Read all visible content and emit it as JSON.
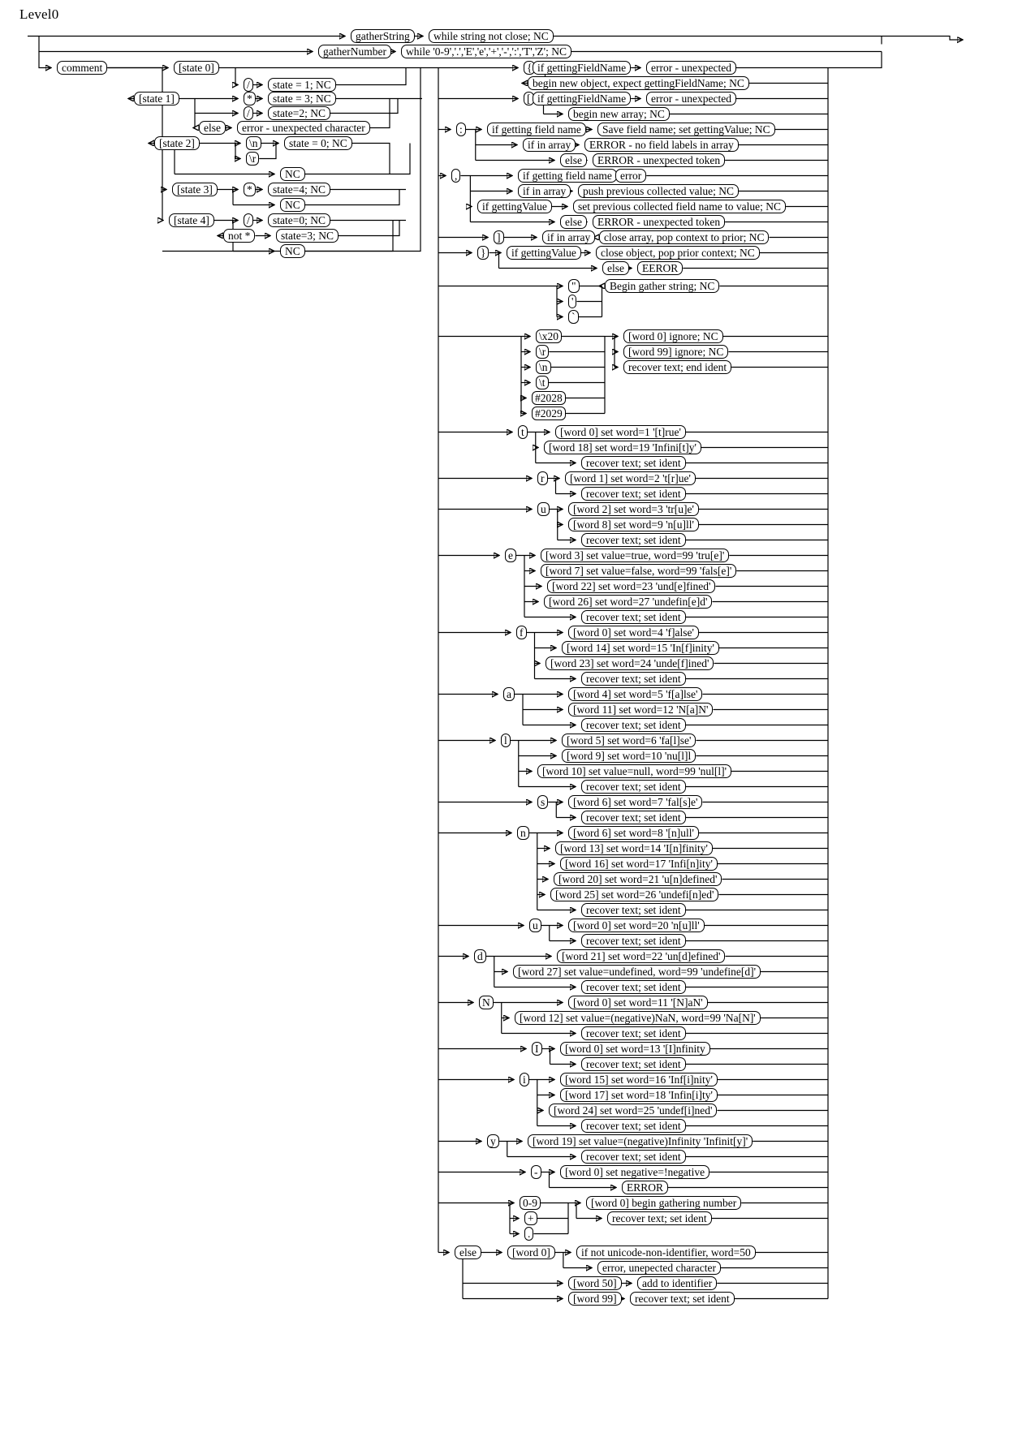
{
  "title": "Level0",
  "diagram": {
    "type": "railroad-syntax-diagram",
    "name": "Level0 JSON tokenizer state machine"
  },
  "top": {
    "gather_string": "gatherString",
    "while_string": "while string not close; NC",
    "gather_number": "gatherNumber",
    "while_number": "while '0-9','.','E','e','+','-',':','T','Z'; NC",
    "comment": "comment"
  },
  "comment_states": {
    "state0": "[state 0]",
    "state0_tok": "/",
    "state0_act": "state = 1; NC",
    "state1": "[state 1]",
    "state1_rows": [
      {
        "tok": "*",
        "act": "state = 3; NC"
      },
      {
        "tok": "/",
        "act": "state=2; NC"
      },
      {
        "tok": "else",
        "act": "error - unexpected character"
      }
    ],
    "state2": "[state 2]",
    "state2_tok_a": "\\n",
    "state2_tok_b": "\\r",
    "state2_act": "state = 0; NC",
    "state2_nc": "NC",
    "state3": "[state 3]",
    "state3_tok": "*",
    "state3_act": "state=4; NC",
    "state3_nc": "NC",
    "state4": "[state 4]",
    "state4_rows": [
      {
        "tok": "/",
        "act": "state=0; NC"
      },
      {
        "tok": "not *",
        "act": "state=3; NC"
      }
    ],
    "state4_nc": "NC"
  },
  "tokens": [
    {
      "id": "open-brace",
      "tok": "{",
      "rows": [
        {
          "cond": "if gettingFieldName",
          "act": "error - unexpected"
        },
        {
          "cond": null,
          "act": "begin new object, expect gettingFieldName; NC"
        }
      ]
    },
    {
      "id": "open-bracket",
      "tok": "[",
      "rows": [
        {
          "cond": "if gettingFieldName",
          "act": "error - unexpected"
        },
        {
          "cond": null,
          "act": "begin new array; NC"
        }
      ]
    },
    {
      "id": "colon",
      "tok": ":",
      "rows": [
        {
          "cond": "if getting field name",
          "act": "Save field name; set gettingValue; NC"
        },
        {
          "cond": "if in array",
          "act": "ERROR - no field labels in array"
        },
        {
          "cond": "else",
          "act": "ERROR - unexpected token"
        }
      ]
    },
    {
      "id": "comma",
      "tok": ",",
      "rows": [
        {
          "cond": "if getting field name",
          "act": "error"
        },
        {
          "cond": "if in array",
          "act": "push previous collected value; NC"
        },
        {
          "cond": "if gettingValue",
          "act": "set previous collected field name to value; NC"
        },
        {
          "cond": "else",
          "act": "ERROR - unexpected token"
        }
      ]
    },
    {
      "id": "close-bracket",
      "tok": "]",
      "rows": [
        {
          "cond": "if in array",
          "act": "close array, pop context to prior; NC"
        }
      ]
    },
    {
      "id": "close-brace",
      "tok": "}",
      "rows": [
        {
          "cond": "if gettingValue",
          "act": "close object, pop prior context; NC"
        },
        {
          "cond": "else",
          "act": "EEROR"
        }
      ]
    }
  ],
  "quotes": {
    "marks": [
      "\"",
      "'",
      "`"
    ],
    "action": "Begin gather string; NC"
  },
  "whitespace": {
    "marks": [
      "\\x20",
      "\\r",
      "\\n",
      "\\t",
      "#2028",
      "#2029"
    ],
    "actions": [
      "[word 0] ignore; NC",
      "[word 99] ignore; NC",
      "recover text; end ident"
    ]
  },
  "letters": [
    {
      "ch": "t",
      "rows": [
        "[word 0] set word=1 '[t]rue'",
        "[word 18] set word=19 'Infini[t]y'",
        "recover text; set ident"
      ]
    },
    {
      "ch": "r",
      "rows": [
        "[word 1] set word=2 't[r]ue'",
        "recover text; set ident"
      ]
    },
    {
      "ch": "u",
      "rows": [
        "[word 2] set word=3 'tr[u]e'",
        "[word 8] set word=9 'n[u]ll'",
        "recover text; set ident"
      ]
    },
    {
      "ch": "e",
      "rows": [
        "[word 3] set value=true, word=99  'tru[e]'",
        "[word 7] set value=false, word=99 'fals[e]'",
        "[word 22] set word=23 'und[e]fined'",
        "[word 26] set word=27 'undefin[e]d'",
        "recover text; set ident"
      ]
    },
    {
      "ch": "f",
      "rows": [
        "[word 0] set word=4  'f]alse'",
        "[word 14] set word=15 'In[f]inity'",
        "[word 23] set word=24 'unde[f]ined'",
        "recover text; set ident"
      ]
    },
    {
      "ch": "a",
      "rows": [
        "[word 4] set word=5 'f[a]lse'",
        "[word 11] set word=12 'N[a]N'",
        "recover text; set ident"
      ]
    },
    {
      "ch": "l",
      "rows": [
        "[word 5] set word=6 'fa[l]se'",
        "[word 9] set word=10 'nu[l]l",
        "[word 10] set value=null, word=99  'nul[l]'",
        "recover text; set ident"
      ]
    },
    {
      "ch": "s",
      "rows": [
        "[word 6] set word=7 'fal[s]e'",
        "recover text; set ident"
      ]
    },
    {
      "ch": "n",
      "rows": [
        "[word 6] set word=8 '[n]ull'",
        "[word 13] set word=14 'I[n]finity'",
        "[word 16] set word=17 'Infi[n]ity'",
        "[word 20] set word=21 'u[n]defined'",
        "[word 25] set word=26 'undefi[n]ed'",
        "recover text; set ident"
      ]
    },
    {
      "ch": "u",
      "rows": [
        "[word 0] set word=20 'n[u]ll'",
        "recover text; set ident"
      ]
    },
    {
      "ch": "d",
      "rows": [
        "[word 21] set word=22 'un[d]efined'",
        "[word 27] set value=undefined, word=99 'undefine[d]'",
        "recover text; set ident"
      ]
    },
    {
      "ch": "N",
      "rows": [
        "[word 0] set word=11 '[N]aN'",
        "[word 12] set value=(negative)NaN, word=99 'Na[N]'",
        "recover text; set ident"
      ]
    },
    {
      "ch": "I",
      "rows": [
        "[word 0] set word=13 '[I]nfinity",
        "recover text; set ident"
      ]
    },
    {
      "ch": "i",
      "rows": [
        "[word 15] set word=16 'Inf[i]nity'",
        "[word 17] set word=18 'Infin[i]ty'",
        "[word 24] set word=25 'undef[i]ned'",
        "recover text; set ident"
      ]
    },
    {
      "ch": "y",
      "rows": [
        "[word 19] set value=(negative)Infinity 'Infinit[y]'",
        "recover text; set ident"
      ]
    },
    {
      "ch": "-",
      "rows": [
        "[word 0] set negative=!negative",
        "ERROR"
      ]
    }
  ],
  "numbers": {
    "marks": [
      "0-9",
      "+",
      "."
    ],
    "rows": [
      "[word 0] begin gathering number",
      "recover text; set ident"
    ]
  },
  "fallback": {
    "else": "else",
    "word0": "[word 0]",
    "word0_rows": [
      "if not unicode-non-identifier, word=50",
      "error, unepected character"
    ],
    "word50": "[word 50]",
    "word50_act": "add to identifier",
    "word99": "[word 99]",
    "word99_act": "recover text; set ident"
  }
}
